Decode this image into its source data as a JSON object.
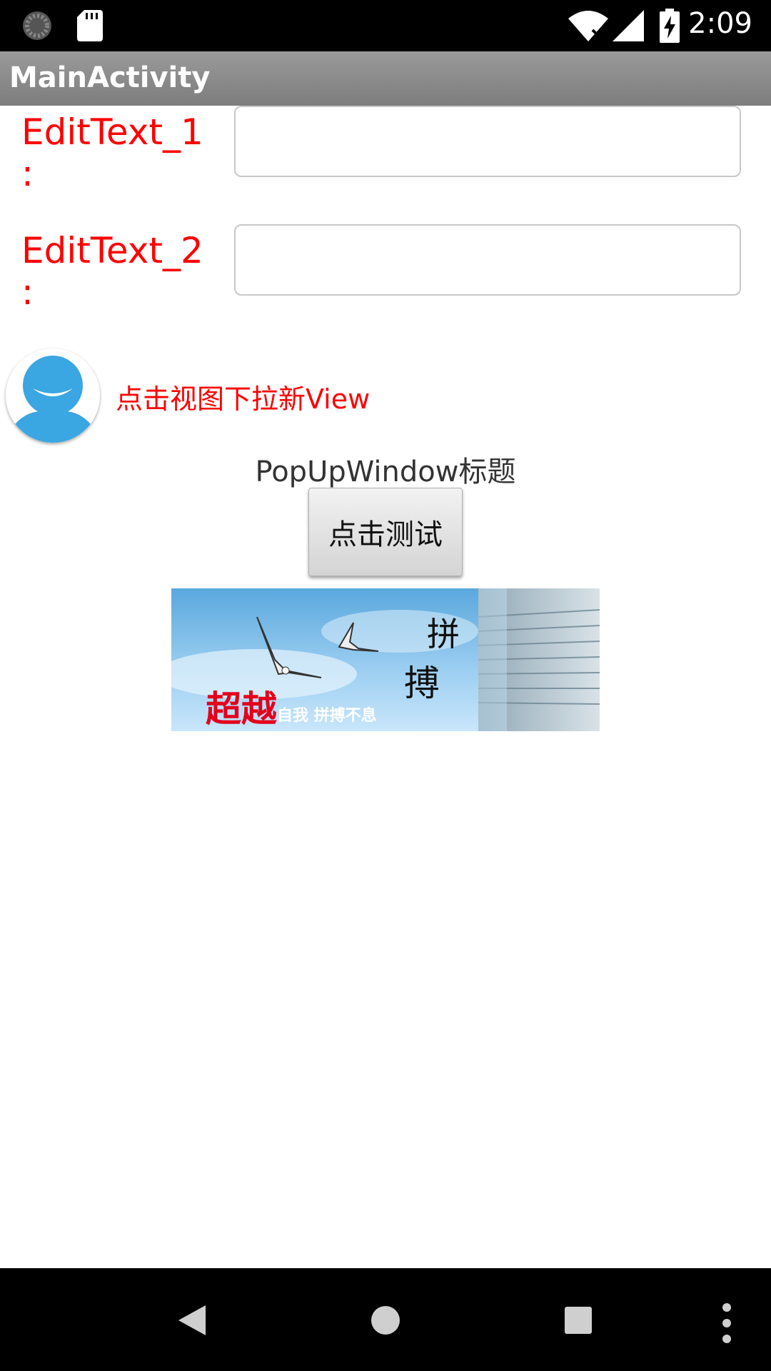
{
  "status_bar": {
    "time": "2:09",
    "icons": [
      "loading-spinner-icon",
      "sd-card-icon",
      "wifi-icon",
      "signal-icon",
      "battery-charging-icon"
    ]
  },
  "action_bar": {
    "title": "MainActivity"
  },
  "form": {
    "field1_label": "EditText_1\n:",
    "field1_value": "",
    "field2_label": "EditText_2\n:",
    "field2_value": ""
  },
  "dropdown_view": {
    "text": "点击视图下拉新View"
  },
  "popup": {
    "title": "PopUpWindow标题",
    "button_label": "点击测试"
  },
  "banner": {
    "main_text": "超越",
    "sub_text": "自我  拼搏不息",
    "calligraphy_1": "拼",
    "calligraphy_2": "搏"
  },
  "colors": {
    "label_red": "#ff0000",
    "action_bar": "#8a8a8a",
    "avatar_blue": "#3aa6e2"
  },
  "nav_bar": {
    "icons": [
      "back-icon",
      "home-icon",
      "recents-icon",
      "overflow-menu-icon"
    ]
  }
}
